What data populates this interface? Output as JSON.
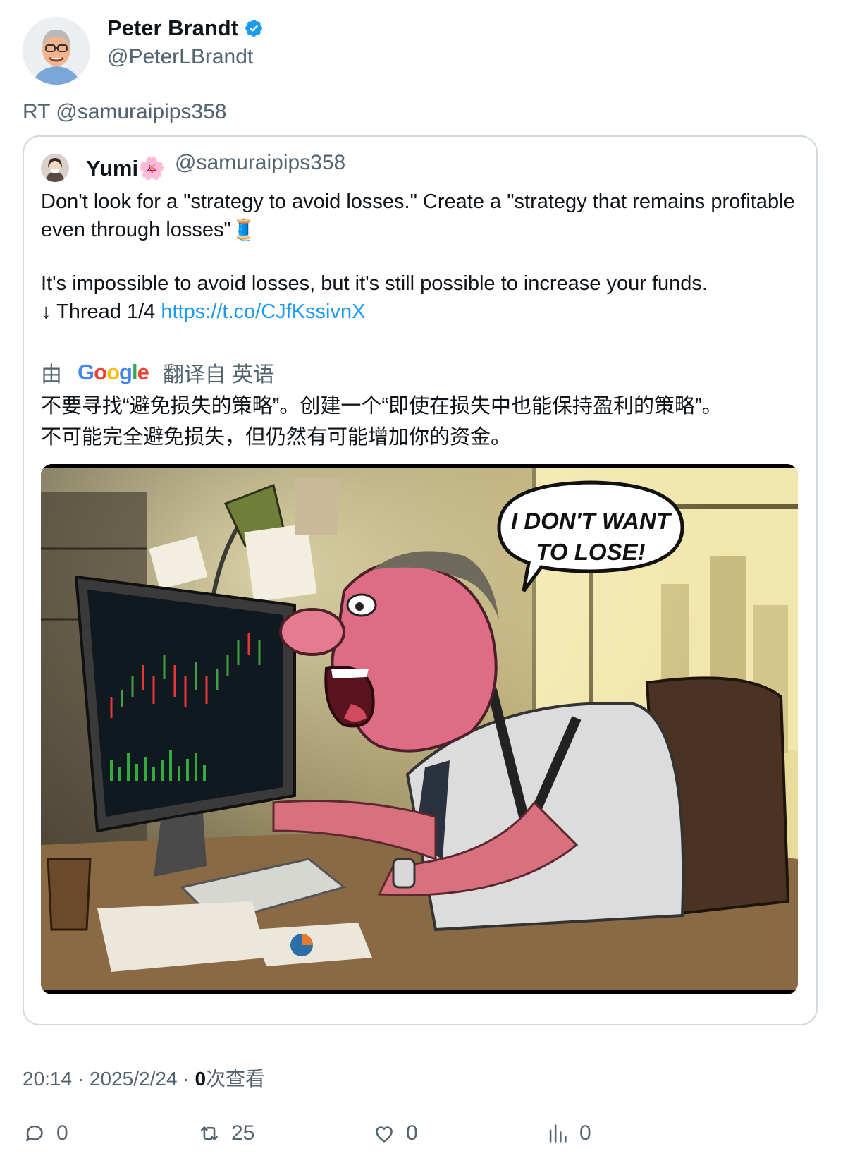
{
  "author": {
    "name": "Peter Brandt",
    "handle": "@PeterLBrandt"
  },
  "retweet_line": "RT @samuraipips358",
  "quoted": {
    "name": "Yumi🌸",
    "handle": "@samuraipips358",
    "text": {
      "line1": "Don't look for a \"strategy to avoid losses.\" Create a \"strategy that remains profitable even through losses\"🧵",
      "line2": "It's impossible to avoid losses, but it's still possible to increase your funds.",
      "line3_prefix": "↓ Thread 1/4 ",
      "link": "https://t.co/CJfKssivnX"
    },
    "translate": {
      "by": "由",
      "google": "Google",
      "from": "翻译自 英语"
    },
    "translation": {
      "line1": "不要寻找“避免损失的策略”。创建一个“即使在损失中也能保持盈利的策略”。",
      "line2": "不可能完全避免损失，但仍然有可能增加你的资金。"
    },
    "image": {
      "speech_bubble_line1": "I DON'T WANT",
      "speech_bubble_line2": "TO LOSE!"
    }
  },
  "meta": {
    "time": "20:14",
    "date": "2025/2/24",
    "views_count": "0",
    "views_label": "次查看"
  },
  "actions": {
    "reply": "0",
    "retweet": "25",
    "like": "0",
    "views": "0"
  },
  "colors": {
    "link": "#1d9bf0",
    "secondary_text": "#536471",
    "verified": "#1d9bf0",
    "border": "#cfd9de"
  },
  "icons": [
    "verified-badge-icon",
    "reply-icon",
    "retweet-icon",
    "like-icon",
    "views-icon"
  ]
}
